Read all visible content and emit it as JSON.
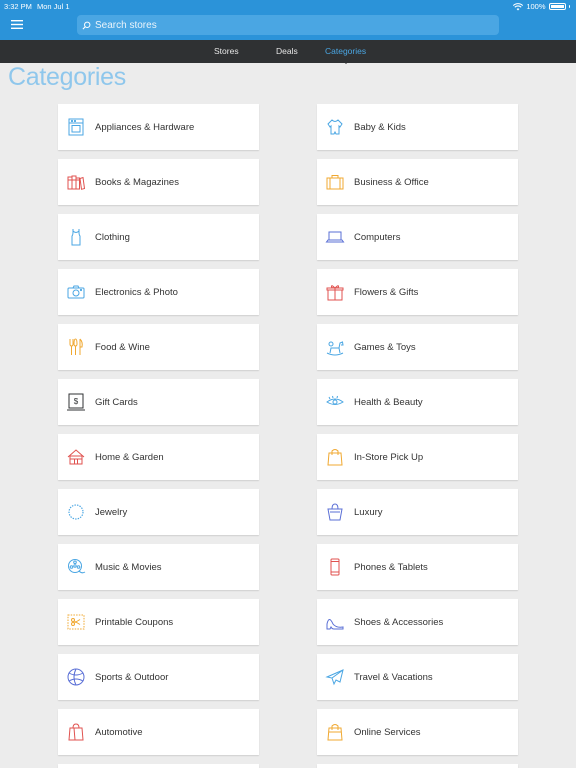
{
  "status_bar": {
    "time": "3:32 PM",
    "date": "Mon Jul 1",
    "battery": "100%"
  },
  "search": {
    "placeholder": "Search stores"
  },
  "tabs": [
    {
      "label": "Stores",
      "active": false
    },
    {
      "label": "Deals",
      "active": false
    },
    {
      "label": "Categories",
      "active": true
    }
  ],
  "page_title": "Categories",
  "colors": {
    "brand": "#2b93d9",
    "accent": "#4aa6e3",
    "title": "#8fc7ec",
    "tabbar": "#2f3133",
    "background": "#ececec"
  },
  "categories": [
    {
      "label": "Appliances & Hardware",
      "icon": "appliance-icon"
    },
    {
      "label": "Baby & Kids",
      "icon": "baby-onesie-icon"
    },
    {
      "label": "Books & Magazines",
      "icon": "books-icon"
    },
    {
      "label": "Business & Office",
      "icon": "briefcase-icon"
    },
    {
      "label": "Clothing",
      "icon": "tank-top-icon"
    },
    {
      "label": "Computers",
      "icon": "laptop-icon"
    },
    {
      "label": "Electronics & Photo",
      "icon": "camera-icon"
    },
    {
      "label": "Flowers & Gifts",
      "icon": "gift-icon"
    },
    {
      "label": "Food & Wine",
      "icon": "cutlery-icon"
    },
    {
      "label": "Games & Toys",
      "icon": "rocking-horse-icon"
    },
    {
      "label": "Gift Cards",
      "icon": "gift-card-icon"
    },
    {
      "label": "Health & Beauty",
      "icon": "eye-lash-icon"
    },
    {
      "label": "Home & Garden",
      "icon": "house-icon"
    },
    {
      "label": "In-Store Pick Up",
      "icon": "shopping-bag-icon"
    },
    {
      "label": "Jewelry",
      "icon": "necklace-icon"
    },
    {
      "label": "Luxury",
      "icon": "luxury-bag-icon"
    },
    {
      "label": "Music & Movies",
      "icon": "film-reel-icon"
    },
    {
      "label": "Phones & Tablets",
      "icon": "phone-icon"
    },
    {
      "label": "Printable Coupons",
      "icon": "coupon-scissors-icon"
    },
    {
      "label": "Shoes & Accessories",
      "icon": "high-heel-icon"
    },
    {
      "label": "Sports & Outdoor",
      "icon": "ball-icon"
    },
    {
      "label": "Travel & Vacations",
      "icon": "airplane-icon"
    },
    {
      "label": "Automotive",
      "icon": "car-seat-icon"
    },
    {
      "label": "Online Services",
      "icon": "online-bag-icon"
    }
  ]
}
